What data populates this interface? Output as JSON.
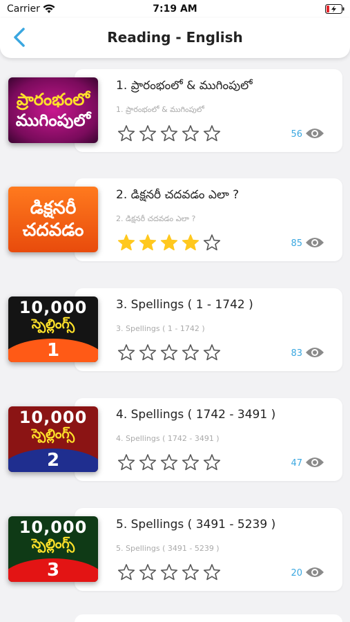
{
  "status": {
    "carrier": "Carrier",
    "time": "7:19 AM"
  },
  "header": {
    "title": "Reading - English"
  },
  "colors": {
    "accent": "#3aa7e0",
    "star_filled": "#ffc81e",
    "star_empty": "#555555"
  },
  "items": [
    {
      "title": "1. ప్రారంభంలో & ముగింపులో",
      "subtitle": "1. ప్రారంభంలో & ముగింపులో",
      "rating": 0,
      "views": "56",
      "thumb": {
        "line1": "ప్రారంభంలో",
        "line2": "ముగింపులో"
      }
    },
    {
      "title": "2. డిక్షనరీ చదవడం ఎలా ?",
      "subtitle": "2. డిక్షనరీ చదవడం ఎలా ?",
      "rating": 4,
      "views": "85",
      "thumb": {
        "line1": "డిక్షనరీ",
        "line2": "చదవడం"
      }
    },
    {
      "title": "3. Spellings ( 1 - 1742 )",
      "subtitle": "3. Spellings ( 1 - 1742 )",
      "rating": 0,
      "views": "83",
      "thumb": {
        "line1": "10,000",
        "line2": "స్పెల్లింగ్స్",
        "number": "1"
      }
    },
    {
      "title": "4. Spellings ( 1742 - 3491 )",
      "subtitle": "4. Spellings ( 1742 - 3491 )",
      "rating": 0,
      "views": "47",
      "thumb": {
        "line1": "10,000",
        "line2": "స్పెల్లింగ్స్",
        "number": "2"
      }
    },
    {
      "title": "5. Spellings ( 3491 - 5239 )",
      "subtitle": "5. Spellings ( 3491 - 5239 )",
      "rating": 0,
      "views": "20",
      "thumb": {
        "line1": "10,000",
        "line2": "స్పెల్లింగ్స్",
        "number": "3"
      }
    }
  ]
}
